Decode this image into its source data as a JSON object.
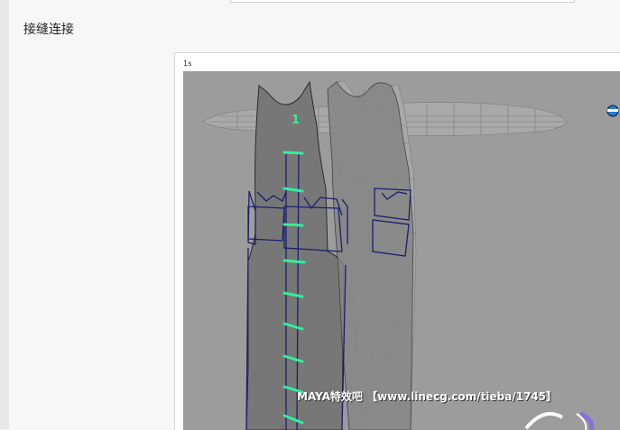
{
  "article": {
    "heading": "接缝连接"
  },
  "figure": {
    "frame_label": "1s",
    "shell_number": "1",
    "watermark": "MAYA特效吧 【www.linecg.com/tieba/1745】"
  },
  "colors": {
    "seam_marks": "#33ee99",
    "uv_border": "#1a1f6e",
    "viewport_bg": "#9c9c9c"
  },
  "icons": [
    "uv-corner-icon",
    "logo-corner-icon"
  ]
}
